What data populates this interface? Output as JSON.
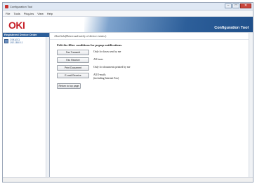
{
  "window": {
    "title": "Configuration Tool",
    "minimize": "–",
    "maximize": "□",
    "close": "✕"
  },
  "menu": [
    "File",
    "Tools",
    "Plug-ins",
    "View",
    "Help"
  ],
  "brand": {
    "logo": "OKI",
    "app_title": "Configuration Tool"
  },
  "sidebar": {
    "header": "Registered Device Order",
    "device": {
      "name": "C941(IC)",
      "ip": "192.168.0.1"
    }
  },
  "main": {
    "breadcrumb": "Alert Info(Detect and notify of device events.)",
    "heading": "Edit the filter conditions for popup notifications.",
    "rows": [
      {
        "button": "Fax Transmit",
        "description": "Only for faxes sent by me"
      },
      {
        "button": "Fax Receive",
        "description": "All faxes"
      },
      {
        "button": "Print Document",
        "description": "Only for documents printed by me"
      },
      {
        "button": "E-mail Receive",
        "description": "All E-mails\n(including Internet Fax)"
      }
    ],
    "return_button": "Return to top page"
  }
}
